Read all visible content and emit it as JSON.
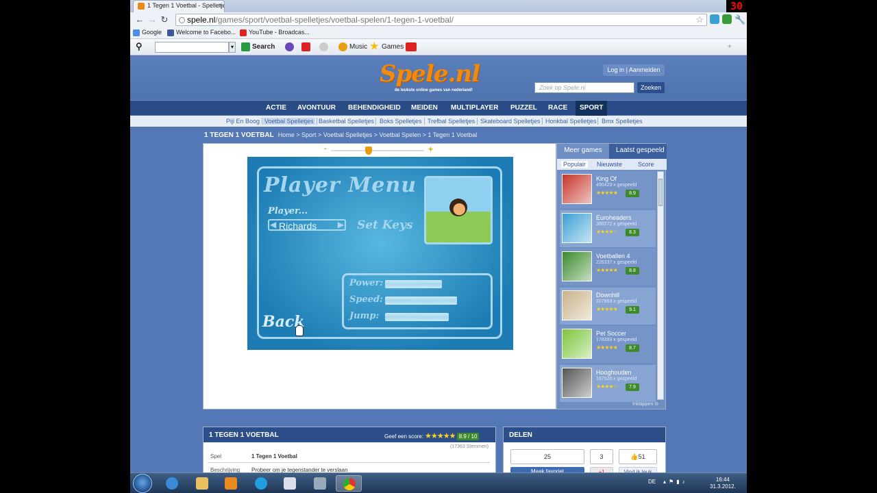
{
  "browser": {
    "tab_title": "1 Tegen 1 Voetbal - Spelletje",
    "tab_close": "×",
    "recording_counter": "30",
    "url_domain": "spele.nl",
    "url_path": "/games/sport/voetbal-spelletjes/voetbal-spelen/1-tegen-1-voetbal/",
    "bookmarks": [
      "Google",
      "Welcome to Facebo...",
      "YouTube - Broadcas..."
    ],
    "search_label": "Search",
    "music_label": "Music",
    "games_label": "Games"
  },
  "site": {
    "logo": "Spele.nl",
    "tagline": "de leukste online games van nederland!",
    "login": "Log in",
    "register": "Aanmelden",
    "search_placeholder": "Zoek op Spele.nl",
    "search_button": "Zoeken",
    "main_nav": [
      "ACTIE",
      "AVONTUUR",
      "BEHENDIGHEID",
      "MEIDEN",
      "MULTIPLAYER",
      "PUZZEL",
      "RACE",
      "SPORT"
    ],
    "sub_nav": [
      "Pijl En Boog",
      "Voetbal Spelletjes",
      "Basketbal Spelletjes",
      "Boks Spelletjes",
      "Trefbal Spelletjes",
      "Skateboard Spelletjes",
      "Honkbal Spelletjes",
      "Bmx Spelletjes"
    ],
    "page_title": "1 TEGEN 1 VOETBAL",
    "breadcrumb": "Home > Sport > Voetbal Spelletjes > Voetbal Spelen > 1 Tegen 1 Voetbal"
  },
  "game": {
    "zoom_minus": "-",
    "zoom_plus": "+",
    "zoom_level": 0.4,
    "title": "Player Menu",
    "player_label": "Player...",
    "player_name": "Richards",
    "set_keys": "Set Keys",
    "stats": [
      {
        "label": "Power:",
        "value": 0.55
      },
      {
        "label": "Speed:",
        "value": 0.7
      },
      {
        "label": "Jump:",
        "value": 0.62
      }
    ],
    "back": "Back"
  },
  "sidebar": {
    "tabs": [
      "Meer games",
      "Laatst gespeeld"
    ],
    "subtabs": [
      "Populair",
      "Nieuwste",
      "Score"
    ],
    "games": [
      {
        "name": "King Of",
        "plays": "490423 x gespeeld",
        "score": "8.9",
        "rating": 5,
        "color": "#c7342a"
      },
      {
        "name": "Euroheaders",
        "plays": "380272 x gespeeld",
        "score": "8.3",
        "rating": 4,
        "color": "#3aa0d4"
      },
      {
        "name": "Voetballen 4",
        "plays": "226337 x gespeeld",
        "score": "8.8",
        "rating": 5,
        "color": "#3a8a2c"
      },
      {
        "name": "Downhill",
        "plays": "207863 x gespeeld",
        "score": "9.1",
        "rating": 5,
        "color": "#c9b48a"
      },
      {
        "name": "Pet Soccer",
        "plays": "178393 x gespeeld",
        "score": "8.7",
        "rating": 5,
        "color": "#7cc63a"
      },
      {
        "name": "Hooghouden",
        "plays": "167520 x gespeeld",
        "score": "7.9",
        "rating": 4,
        "color": "#555555"
      }
    ],
    "collapse": "Inklappen"
  },
  "info": {
    "title": "1 TEGEN 1 VOETBAL",
    "rate_label": "Geef een score:",
    "rate_value": "8.9 / 10",
    "votes": "(17363 Stemmen)",
    "rows": [
      {
        "key": "Spel",
        "value": "1 Tegen 1 Voetbal"
      },
      {
        "key": "Beschrijving",
        "value": "Probeer om je tegenstander te verslaan"
      }
    ]
  },
  "share": {
    "title": "DELEN",
    "favorites_count": "25",
    "gplus_count": "3",
    "like_count": "51",
    "favorite_button": "Maak favoriet",
    "gplus_button": "+1",
    "like_button": "Vind ik leuk"
  },
  "taskbar": {
    "language": "DE",
    "time": "16:44",
    "date": "31.3.2012."
  }
}
